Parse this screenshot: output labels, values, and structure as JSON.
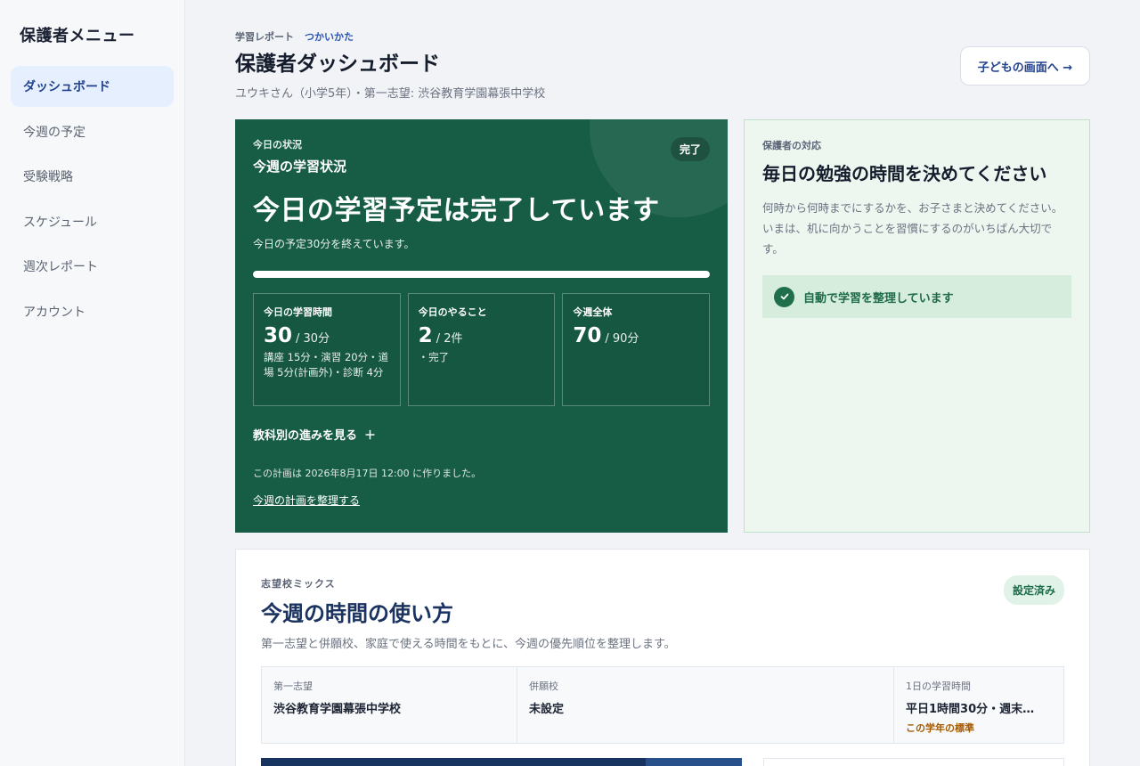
{
  "sidebar": {
    "title": "保護者メニュー",
    "items": [
      {
        "label": "ダッシュボード",
        "active": true
      },
      {
        "label": "今週の予定"
      },
      {
        "label": "受験戦略"
      },
      {
        "label": "スケジュール"
      },
      {
        "label": "週次レポート"
      },
      {
        "label": "アカウント"
      }
    ]
  },
  "header": {
    "eyebrow": "学習レポート",
    "help_link": "つかいかた",
    "title": "保護者ダッシュボード",
    "subtitle": "ユウキさん（小学5年）・第一志望: 渋谷教育学園幕張中学校",
    "child_screen_button": "子どもの画面へ →"
  },
  "status_card": {
    "label": "今日の状況",
    "week_title": "今週の学習状況",
    "badge": "完了",
    "headline": "今日の学習予定は完了しています",
    "description": "今日の予定30分を終えています。",
    "progress_percent": 100,
    "metrics": [
      {
        "label": "今日の学習時間",
        "value": "30",
        "unit": "/ 30分",
        "detail": "講座 15分・演習 20分・道場 5分(計画外)・診断 4分"
      },
      {
        "label": "今日のやること",
        "value": "2",
        "unit": "/ 2件",
        "detail": "・完了"
      },
      {
        "label": "今週全体",
        "value": "70",
        "unit": "/ 90分",
        "detail": ""
      }
    ],
    "subject_toggle": "教科別の進みを見る",
    "subject_toggle_icon": "＋",
    "created_note": "この計画は 2026年8月17日 12:00 に作りました。",
    "organize_link": "今週の計画を整理する"
  },
  "guardian_card": {
    "label": "保護者の対応",
    "title": "毎日の勉強の時間を決めてください",
    "body": "何時から何時までにするかを、お子さまと決めてください。いまは、机に向かうことを習慣にするのがいちばん大切です。",
    "auto_status": "自動で学習を整理しています"
  },
  "mix_card": {
    "label": "志望校ミックス",
    "title": "今週の時間の使い方",
    "description": "第一志望と併願校、家庭で使える時間をもとに、今週の優先順位を整理します。",
    "badge": "設定済み",
    "cells": [
      {
        "label": "第一志望",
        "value": "渋谷教育学園幕張中学校",
        "note": ""
      },
      {
        "label": "併願校",
        "value": "未設定",
        "note": ""
      },
      {
        "label": "1日の学習時間",
        "value": "平日1時間30分・週末…",
        "note": "この学年の標準"
      }
    ]
  },
  "colors": {
    "status_card_bg": "#175d45",
    "guardian_card_bg": "#edf7f0",
    "active_nav_bg": "#e6effd",
    "accent_blue": "#24438f",
    "note_orange": "#a35a00"
  }
}
